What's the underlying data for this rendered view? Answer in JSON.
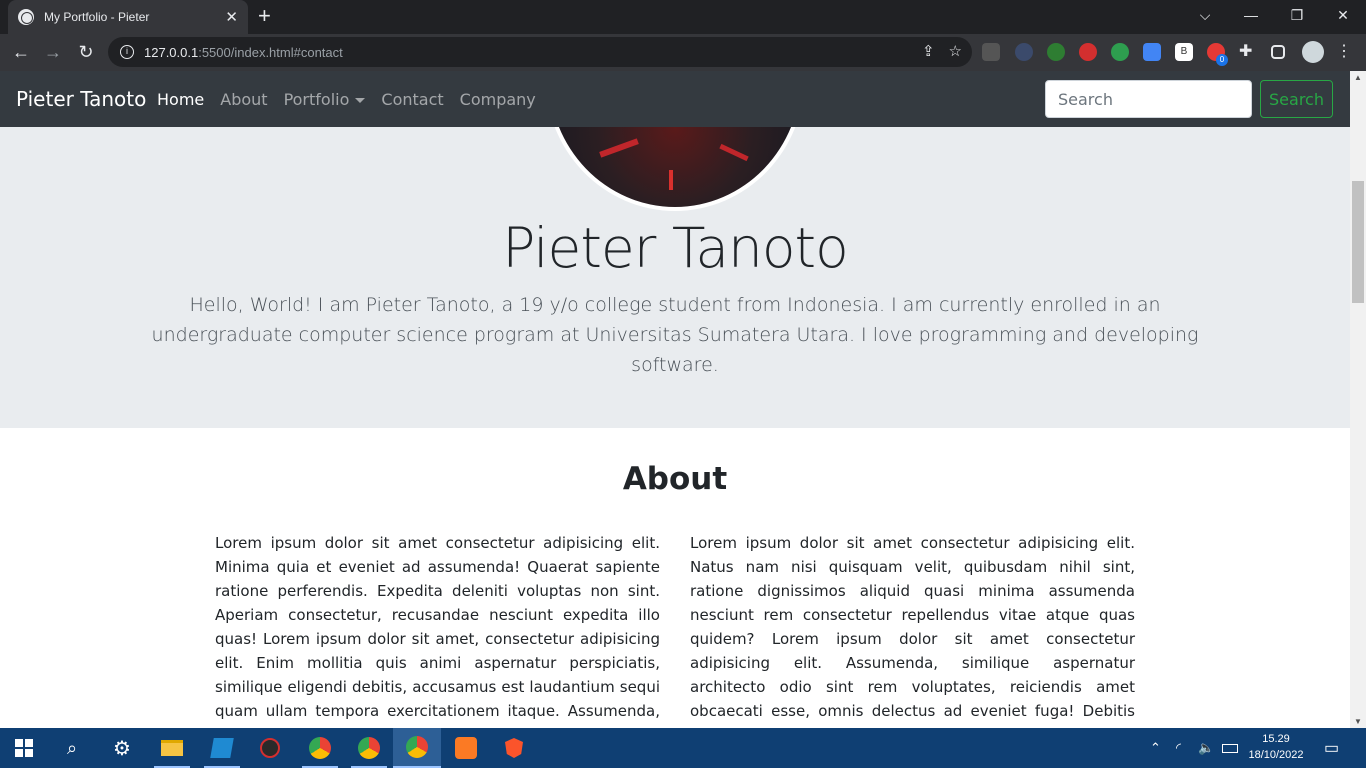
{
  "browser": {
    "tab_title": "My Portfolio - Pieter",
    "tab_close": "✕",
    "new_tab": "+",
    "url_host": "127.0.0.1",
    "url_rest": ":5500/index.html#contact",
    "controls": {
      "minimize": "—",
      "maximize": "❐",
      "close": "✕",
      "dropdown": "⌵"
    }
  },
  "navbar": {
    "brand": "Pieter Tanoto",
    "links": [
      "Home",
      "About",
      "Portfolio",
      "Contact",
      "Company"
    ],
    "search_placeholder": "Search",
    "search_button": "Search"
  },
  "hero": {
    "name": "Pieter Tanoto",
    "lead": "Hello, World! I am Pieter Tanoto, a 19 y/o college student from Indonesia. I am currently enrolled in an undergraduate computer science program at Universitas Sumatera Utara. I love programming and developing software."
  },
  "about": {
    "title": "About",
    "col1": "Lorem ipsum dolor sit amet consectetur adipisicing elit. Minima quia et eveniet ad assumenda! Quaerat sapiente ratione perferendis. Expedita deleniti voluptas non sint. Aperiam consectetur, recusandae nesciunt expedita illo quas! Lorem ipsum dolor sit amet, consectetur adipisicing elit. Enim mollitia quis animi aspernatur perspiciatis, similique eligendi debitis, accusamus est laudantium sequi quam ullam tempora exercitationem itaque. Assumenda, sit consequatur. Eos.",
    "col2": "Lorem ipsum dolor sit amet consectetur adipisicing elit. Natus nam nisi quisquam velit, quibusdam nihil sint, ratione dignissimos aliquid quasi minima assumenda nesciunt rem consectetur repellendus vitae atque quas quidem? Lorem ipsum dolor sit amet consectetur adipisicing elit. Assumenda, similique aspernatur architecto odio sint rem voluptates, reiciendis amet obcaecati esse, omnis delectus ad eveniet fuga! Debitis perspiciatis perferendis hic molestias?"
  },
  "taskbar": {
    "time": "15.29",
    "date": "18/10/2022",
    "ext_badge": "0"
  },
  "colors": {
    "navbar_bg": "#343a40",
    "jumbotron_bg": "#e9ecef",
    "success": "#28a745",
    "taskbar_bg": "#0f3f73"
  }
}
